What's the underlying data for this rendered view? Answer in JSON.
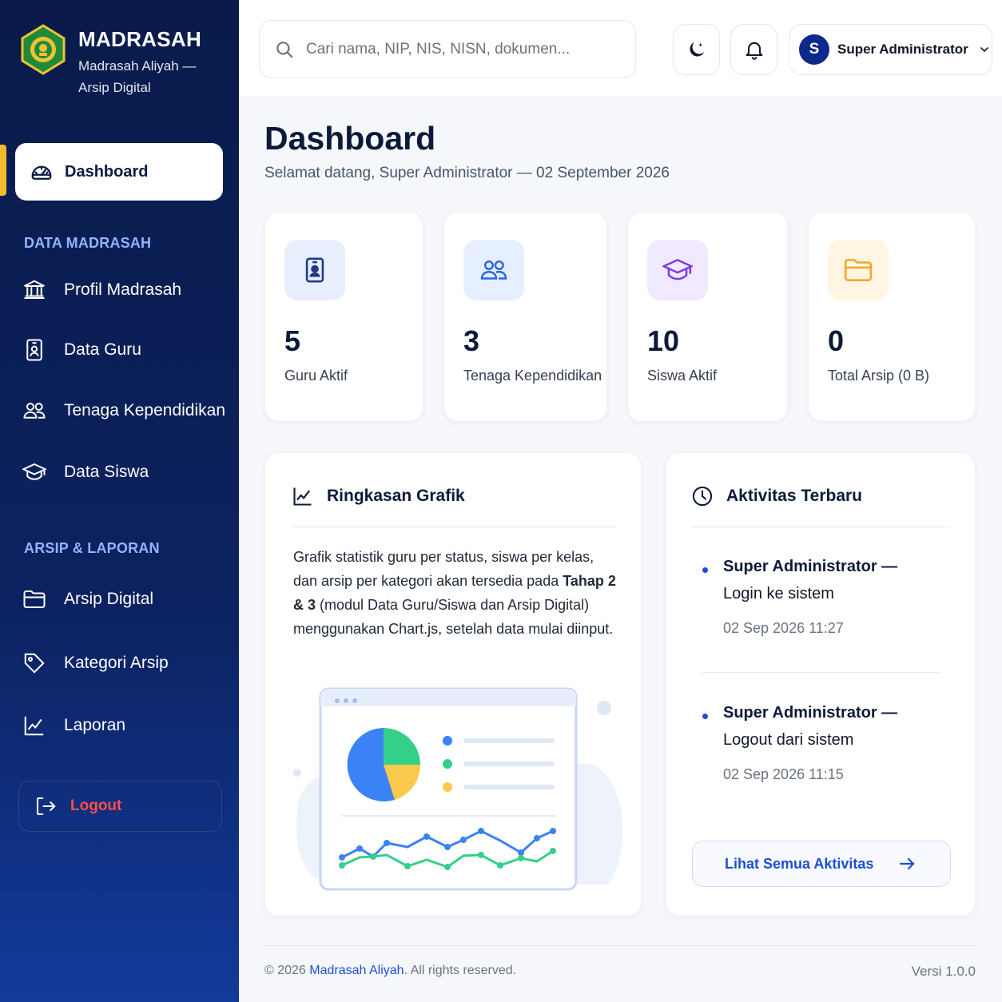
{
  "brand": {
    "title": "MADRASAH",
    "subtitle": "Madrasah Aliyah — Arsip Digital",
    "logo_icon": "madrasah-emblem-icon"
  },
  "sidebar": {
    "active_item": {
      "label": "Dashboard",
      "icon": "dashboard-gauge-icon"
    },
    "sections": [
      {
        "title": "DATA MADRASAH",
        "items": [
          {
            "label": "Profil Madrasah",
            "icon": "building-icon"
          },
          {
            "label": "Data Guru",
            "icon": "id-badge-icon"
          },
          {
            "label": "Tenaga Kependidikan",
            "icon": "users-icon"
          },
          {
            "label": "Data Siswa",
            "icon": "graduation-cap-icon"
          }
        ]
      },
      {
        "title": "ARSIP & LAPORAN",
        "items": [
          {
            "label": "Arsip Digital",
            "icon": "folder-icon"
          },
          {
            "label": "Kategori Arsip",
            "icon": "tag-icon"
          },
          {
            "label": "Laporan",
            "icon": "line-chart-icon"
          }
        ]
      }
    ],
    "logout_label": "Logout"
  },
  "topbar": {
    "search_placeholder": "Cari nama, NIP, NIS, NISN, dokumen...",
    "user_initial": "S",
    "user_name": "Super Administrator"
  },
  "main": {
    "title": "Dashboard",
    "subtitle": "Selamat datang, Super Administrator — 02 September 2026",
    "stats": [
      {
        "value": "5",
        "label": "Guru Aktif",
        "icon": "id-badge-icon",
        "color": "#1e3a8a",
        "bg": "#e8eefb"
      },
      {
        "value": "3",
        "label": "Tenaga Kependidikan",
        "icon": "users-icon",
        "color": "#2563eb",
        "bg": "#e6efff"
      },
      {
        "value": "10",
        "label": "Siswa Aktif",
        "icon": "graduation-cap-icon",
        "color": "#7c3aed",
        "bg": "#f1eafe"
      },
      {
        "value": "0",
        "label": "Total Arsip (0 B)",
        "icon": "folder-icon",
        "color": "#f5a524",
        "bg": "#fff5e3"
      }
    ],
    "chart_card": {
      "title": "Ringkasan Grafik",
      "desc_1": "Grafik statistik guru per status, siswa per kelas, dan arsip per kategori akan tersedia pada ",
      "desc_bold": "Tahap 2 & 3",
      "desc_2": " (modul Data Guru/Siswa dan Arsip Digital) menggunakan Chart.js, setelah data mulai diinput."
    },
    "activity_card": {
      "title": "Aktivitas Terbaru",
      "items": [
        {
          "who": "Super Administrator —",
          "what": "Login ke sistem",
          "when": "02 Sep 2026 11:27"
        },
        {
          "who": "Super Administrator —",
          "what": "Logout dari sistem",
          "when": "02 Sep 2026 11:15"
        }
      ],
      "see_all_label": "Lihat Semua Aktivitas"
    }
  },
  "footer": {
    "copyright_prefix": "© 2026 ",
    "brand": "Madrasah Aliyah",
    "copyright_suffix": ". All rights reserved.",
    "version": "Versi 1.0.0"
  },
  "colors": {
    "sidebar_top": "#0a1b4a",
    "sidebar_bottom": "#123a9a",
    "accent_gold": "#f5b82e",
    "primary_blue": "#1d4ed8",
    "logout_red": "#ff4d4f"
  }
}
